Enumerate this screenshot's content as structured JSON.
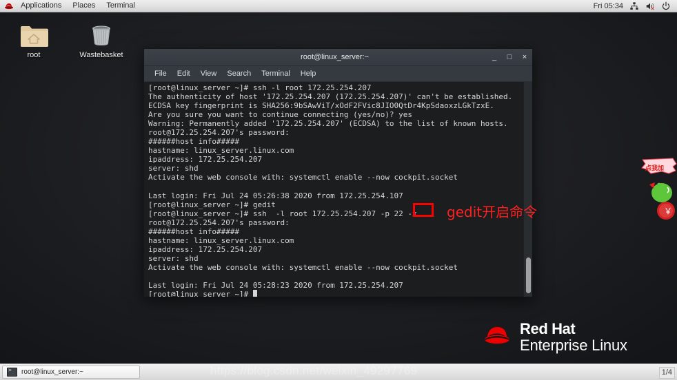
{
  "top_panel": {
    "logo_icon": "redhat-logo-icon",
    "menus": [
      "Applications",
      "Places",
      "Terminal"
    ],
    "clock": "Fri 05:34",
    "tray": [
      "network-icon",
      "volume-muted-icon",
      "power-icon"
    ]
  },
  "desktop": {
    "icons": [
      {
        "name": "root",
        "icon": "home-folder-icon"
      },
      {
        "name": "Wastebasket",
        "icon": "trash-bin-icon"
      }
    ],
    "brand": {
      "icon": "redhat-fedora-icon",
      "line1": "Red Hat",
      "line2": "Enterprise Linux"
    },
    "sticker": {
      "icon": "promo-mascot-icon",
      "bubble_text": "点我加"
    }
  },
  "terminal": {
    "title": "root@linux_server:~",
    "window_buttons": {
      "minimize": "_",
      "maximize": "□",
      "close": "×"
    },
    "menu": [
      "File",
      "Edit",
      "View",
      "Search",
      "Terminal",
      "Help"
    ],
    "lines": [
      "[root@linux_server ~]# ssh -l root 172.25.254.207",
      "The authenticity of host '172.25.254.207 (172.25.254.207)' can't be established.",
      "ECDSA key fingerprint is SHA256:9bSAwViT/xOdF2FVic8JIO0QtDr4KpSdaoxzLGkTzxE.",
      "Are you sure you want to continue connecting (yes/no)? yes",
      "Warning: Permanently added '172.25.254.207' (ECDSA) to the list of known hosts.",
      "root@172.25.254.207's password:",
      "######host info#####",
      "hastname: linux_server.linux.com",
      "ipaddress: 172.25.254.207",
      "server: shd",
      "Activate the web console with: systemctl enable --now cockpit.socket",
      "",
      "Last login: Fri Jul 24 05:26:38 2020 from 172.25.254.107",
      "[root@linux_server ~]# gedit",
      "[root@linux_server ~]# ssh  -l root 172.25.254.207 -p 22 -x",
      "root@172.25.254.207's password:",
      "######host info#####",
      "hastname: linux_server.linux.com",
      "ipaddress: 172.25.254.207",
      "server: shd",
      "Activate the web console with: systemctl enable --now cockpit.socket",
      "",
      "Last login: Fri Jul 24 05:28:23 2020 from 172.25.254.207",
      "[root@linux_server ~]# "
    ],
    "scrollbar": "vertical-scrollbar"
  },
  "annotation": {
    "highlight_color": "#ff0000",
    "boxed_text": "-x",
    "label": "gedit开启命令"
  },
  "taskbar": {
    "window_button": {
      "icon": "terminal-icon",
      "label": "root@linux_server:~"
    },
    "watermark": "https://blog.csdn.net/weixin_49297769",
    "page_indicator": "1/4"
  }
}
